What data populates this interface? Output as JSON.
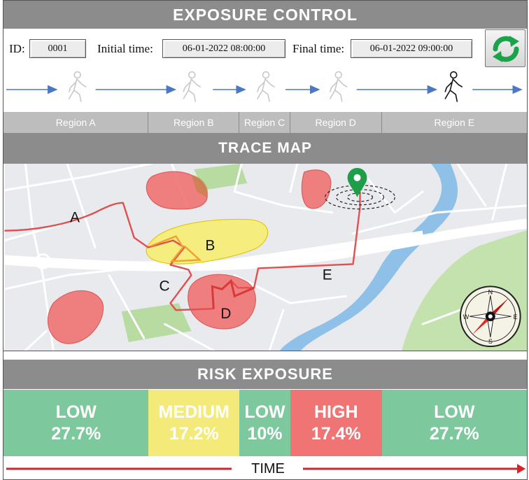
{
  "headers": {
    "exposure_control": "EXPOSURE CONTROL",
    "trace_map": "TRACE MAP",
    "risk_exposure": "RISK EXPOSURE"
  },
  "controls": {
    "id_label": "ID:",
    "id_value": "0001",
    "initial_label": "Initial time:",
    "initial_value": "06-01-2022 08:00:00",
    "final_label": "Final time:",
    "final_value": "06-01-2022 09:00:00",
    "refresh_icon": "refresh-icon"
  },
  "regions": [
    "Region A",
    "Region B",
    "Region C",
    "Region D",
    "Region E"
  ],
  "map": {
    "labels": [
      "A",
      "B",
      "C",
      "D",
      "E"
    ],
    "compass": {
      "n": "N",
      "s": "S",
      "e": "E",
      "w": "W"
    }
  },
  "risk": [
    {
      "level": "LOW",
      "percent": "27.7%",
      "color": "#7ec89d"
    },
    {
      "level": "MEDIUM",
      "percent": "17.2%",
      "color": "#f4ea7a"
    },
    {
      "level": "LOW",
      "percent": "10%",
      "color": "#7ec89d"
    },
    {
      "level": "HIGH",
      "percent": "17.4%",
      "color": "#f07474"
    },
    {
      "level": "LOW",
      "percent": "27.7%",
      "color": "#7ec89d"
    }
  ],
  "time_label": "TIME",
  "colors": {
    "header": "#8c8c8c",
    "arrow_blue": "#4a78c2",
    "route_red": "#e05050",
    "time_arrow_red": "#d8232a",
    "pin_green": "#1f9e4a"
  }
}
